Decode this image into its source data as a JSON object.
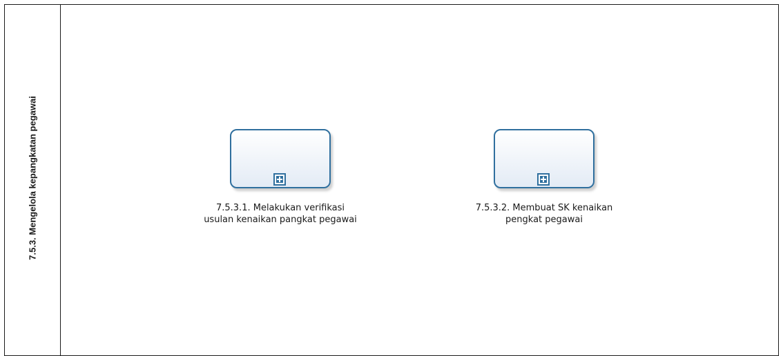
{
  "lane": {
    "title": "7.5.3. Mengelola kepangkatan pegawai"
  },
  "tasks": [
    {
      "line1": "7.5.3.1. Melakukan verifikasi",
      "line2": "usulan kenaikan pangkat pegawai",
      "marker": "subprocess-plus-icon"
    },
    {
      "line1": "7.5.3.2. Membuat SK kenaikan",
      "line2": "pengkat pegawai",
      "marker": "subprocess-plus-icon"
    }
  ],
  "colors": {
    "task_border": "#2f6f9e",
    "lane_border": "#1a1a1a"
  }
}
